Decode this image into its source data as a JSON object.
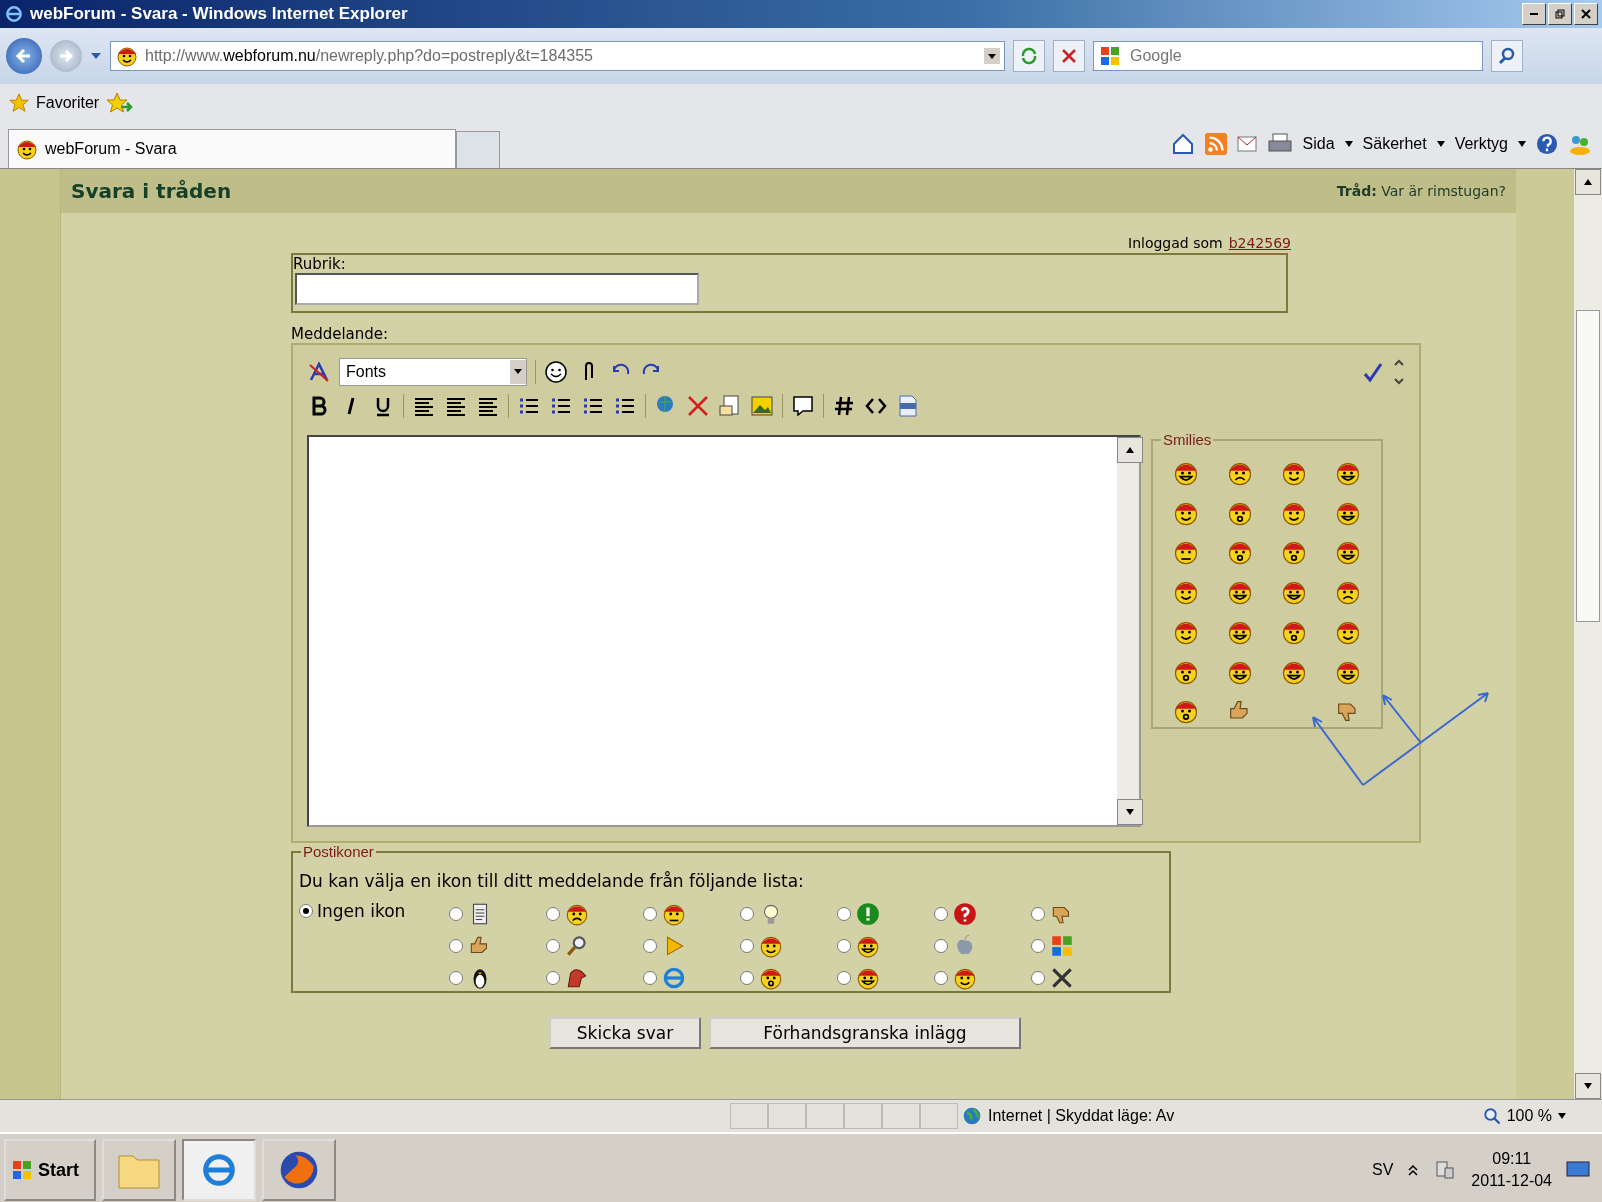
{
  "window": {
    "title": "webForum - Svara - Windows Internet Explorer"
  },
  "address_bar": {
    "url": "http://www.**webforum.nu**/newreply.php?do=postreply&t=184355",
    "search_placeholder": "Google"
  },
  "favorites": {
    "label": "Favoriter"
  },
  "tabs": [
    {
      "label": "webForum - Svara",
      "selected": true
    }
  ],
  "command_bar": {
    "menus": [
      "Sida",
      "Säkerhet",
      "Verktyg"
    ]
  },
  "page": {
    "heading": "Svara i tråden",
    "thread_label": "Tråd:",
    "thread_title": "Var är rimstugan?",
    "logged_in_label": "Inloggad som",
    "username": "b242569",
    "subject_label": "Rubrik:",
    "message_label": "Meddelande:"
  },
  "editor": {
    "font_select": "Fonts",
    "smilies_legend": "Smilies"
  },
  "post_icons": {
    "legend": "Postikoner",
    "instructions": "Du kan välja en ikon till ditt meddelande från följande lista:",
    "none_option": {
      "label": "Ingen ikon",
      "selected": true
    },
    "options": [
      {
        "kind": "document",
        "selected": false
      },
      {
        "kind": "frown",
        "selected": false
      },
      {
        "kind": "angry",
        "selected": false
      },
      {
        "kind": "bulb",
        "selected": false
      },
      {
        "kind": "exclaim",
        "selected": false
      },
      {
        "kind": "question",
        "selected": false
      },
      {
        "kind": "thumb-down",
        "selected": false
      },
      {
        "kind": "thumb-up",
        "selected": false
      },
      {
        "kind": "magnifier",
        "selected": false
      },
      {
        "kind": "arrow",
        "selected": false
      },
      {
        "kind": "smile",
        "selected": false
      },
      {
        "kind": "grin",
        "selected": false
      },
      {
        "kind": "apple",
        "selected": false
      },
      {
        "kind": "windows",
        "selected": false
      },
      {
        "kind": "penguin",
        "selected": false
      },
      {
        "kind": "dino",
        "selected": false
      },
      {
        "kind": "browser",
        "selected": false
      },
      {
        "kind": "shout",
        "selected": false
      },
      {
        "kind": "grin",
        "selected": false
      },
      {
        "kind": "smile",
        "selected": false
      },
      {
        "kind": "tools",
        "selected": false
      }
    ]
  },
  "buttons": [
    {
      "label": "Skicka svar"
    },
    {
      "label": "Förhandsgranska inlägg"
    }
  ],
  "status_bar": {
    "zone": "Internet | Skyddat läge: Av",
    "zoom": "100 %"
  },
  "taskbar": {
    "start": "Start",
    "language": "SV",
    "time": "09:11",
    "date": "2011-12-04"
  }
}
